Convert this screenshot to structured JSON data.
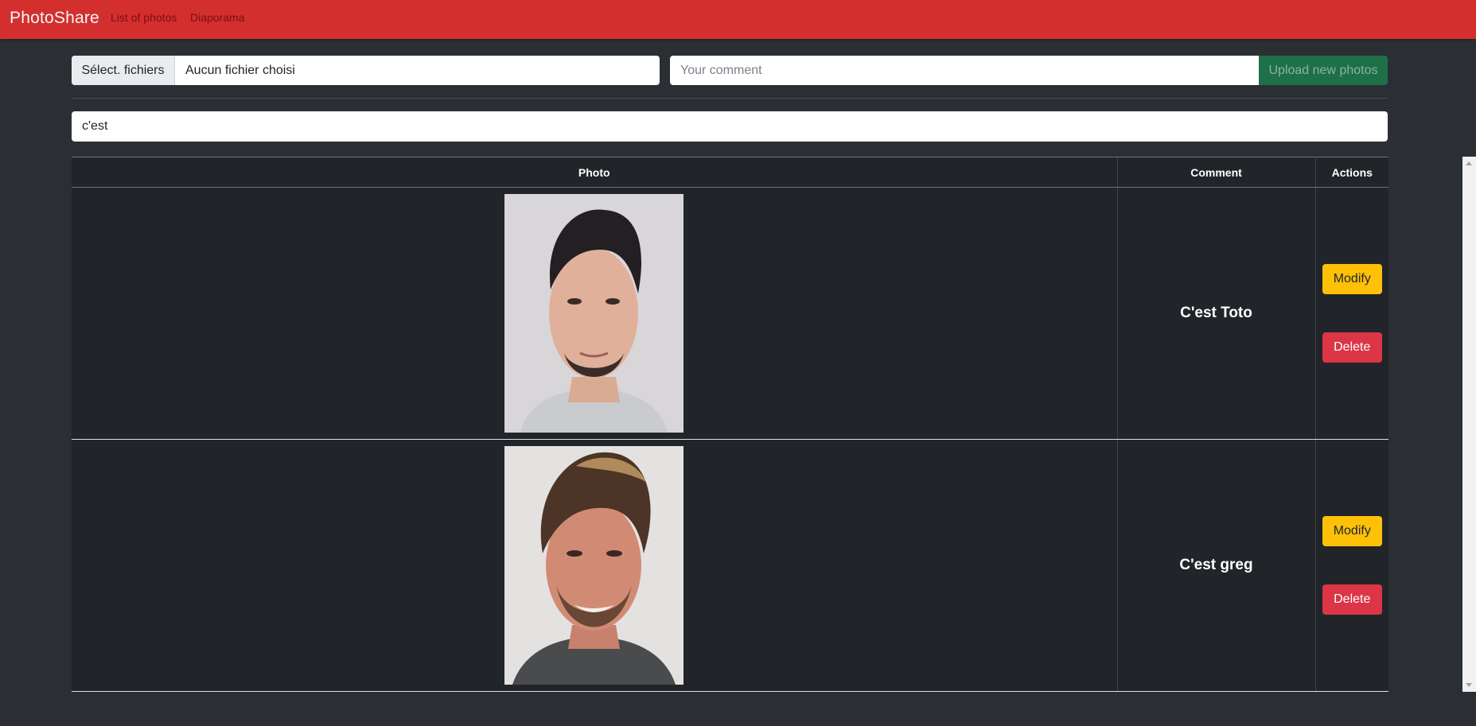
{
  "navbar": {
    "brand": "PhotoShare",
    "links": [
      "List of photos",
      "Diaporama"
    ]
  },
  "upload": {
    "file_button_label": "Sélect. fichiers",
    "file_status": "Aucun fichier choisi",
    "comment_placeholder": "Your comment",
    "upload_button_label": "Upload new photos"
  },
  "search": {
    "value": "c'est"
  },
  "table": {
    "headers": {
      "photo": "Photo",
      "comment": "Comment",
      "actions": "Actions"
    },
    "rows": [
      {
        "comment": "C'est Toto",
        "modify_label": "Modify",
        "delete_label": "Delete"
      },
      {
        "comment": "C'est greg",
        "modify_label": "Modify",
        "delete_label": "Delete"
      }
    ]
  },
  "colors": {
    "navbar": "#d32f2f",
    "page_background": "#2b2f34",
    "table_background": "#212529",
    "upload_button": "#1e7048",
    "modify_button": "#ffc107",
    "delete_button": "#dc3545"
  }
}
